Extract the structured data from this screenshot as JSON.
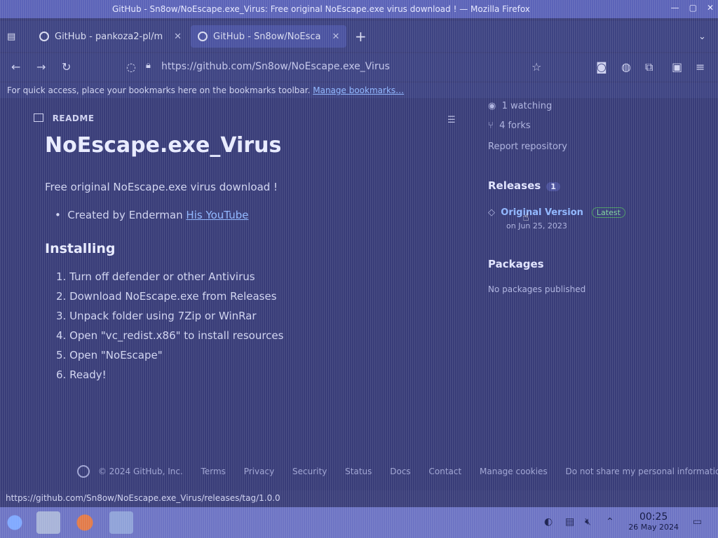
{
  "window": {
    "title": "GitHub - Sn8ow/NoEscape.exe_Virus: Free original NoEscape.exe virus download ! — Mozilla Firefox"
  },
  "tabs": [
    {
      "label": "GitHub - pankoza2-pl/m"
    },
    {
      "label": "GitHub - Sn8ow/NoEsca"
    }
  ],
  "nav": {
    "url": "https://github.com/Sn8ow/NoEscape.exe_Virus"
  },
  "bookmarks": {
    "text": "For quick access, place your bookmarks here on the bookmarks toolbar.",
    "link": "Manage bookmarks…"
  },
  "readme": {
    "header": "README",
    "title": "NoEscape.exe_Virus",
    "description": "Free original NoEscape.exe virus download !",
    "bullet_prefix": "Created by Enderman",
    "bullet_link": "His YouTube",
    "section": "Installing",
    "steps": [
      "1. Turn off defender or other Antivirus",
      "2. Download NoEscape.exe from Releases",
      "3. Unpack folder using 7Zip or WinRar",
      "4. Open \"vc_redist.x86\" to install resources",
      "5. Open \"NoEscape\"",
      "6. Ready!"
    ]
  },
  "sidebar": {
    "watching": "1 watching",
    "forks": "4 forks",
    "report": "Report repository",
    "releases_title": "Releases",
    "releases_count": "1",
    "release_name": "Original Version",
    "release_badge": "Latest",
    "release_date": "on Jun 25, 2023",
    "packages_title": "Packages",
    "packages_text": "No packages published"
  },
  "footer": {
    "copyright": "© 2024 GitHub, Inc.",
    "links": [
      "Terms",
      "Privacy",
      "Security",
      "Status",
      "Docs",
      "Contact",
      "Manage cookies",
      "Do not share my personal information"
    ]
  },
  "status_url": "https://github.com/Sn8ow/NoEscape.exe_Virus/releases/tag/1.0.0",
  "clock": {
    "time": "00:25",
    "date": "26 May 2024"
  }
}
